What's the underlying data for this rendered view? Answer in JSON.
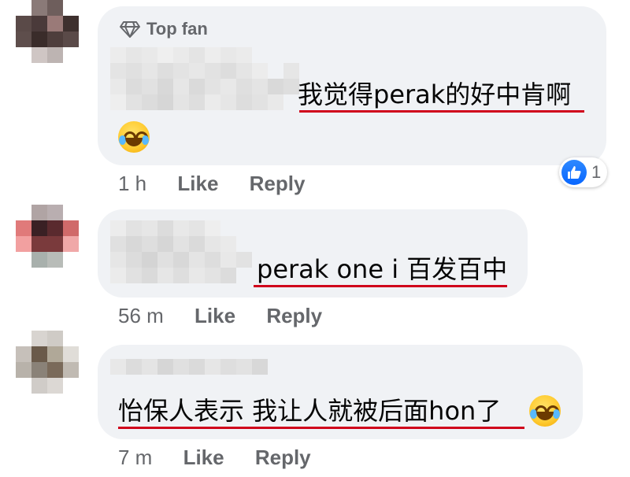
{
  "comments": [
    {
      "top_fan_label": "Top fan",
      "text": "我觉得perak的好中肯啊",
      "time": "1 h",
      "like_label": "Like",
      "reply_label": "Reply",
      "reaction_count": "1",
      "reaction_icon": "thumbs-up-icon",
      "emoji": "laughing-tears-emoji"
    },
    {
      "text": "perak one i 百发百中",
      "time": "56 m",
      "like_label": "Like",
      "reply_label": "Reply"
    },
    {
      "text": "怡保人表示 我让人就被后面hon了",
      "time": "7 m",
      "like_label": "Like",
      "reply_label": "Reply",
      "emoji": "laughing-tears-emoji"
    }
  ],
  "colors": {
    "bubble": "#f0f2f5",
    "underline": "#d0021b",
    "meta": "#65676b",
    "like_blue": "#0866ff"
  }
}
